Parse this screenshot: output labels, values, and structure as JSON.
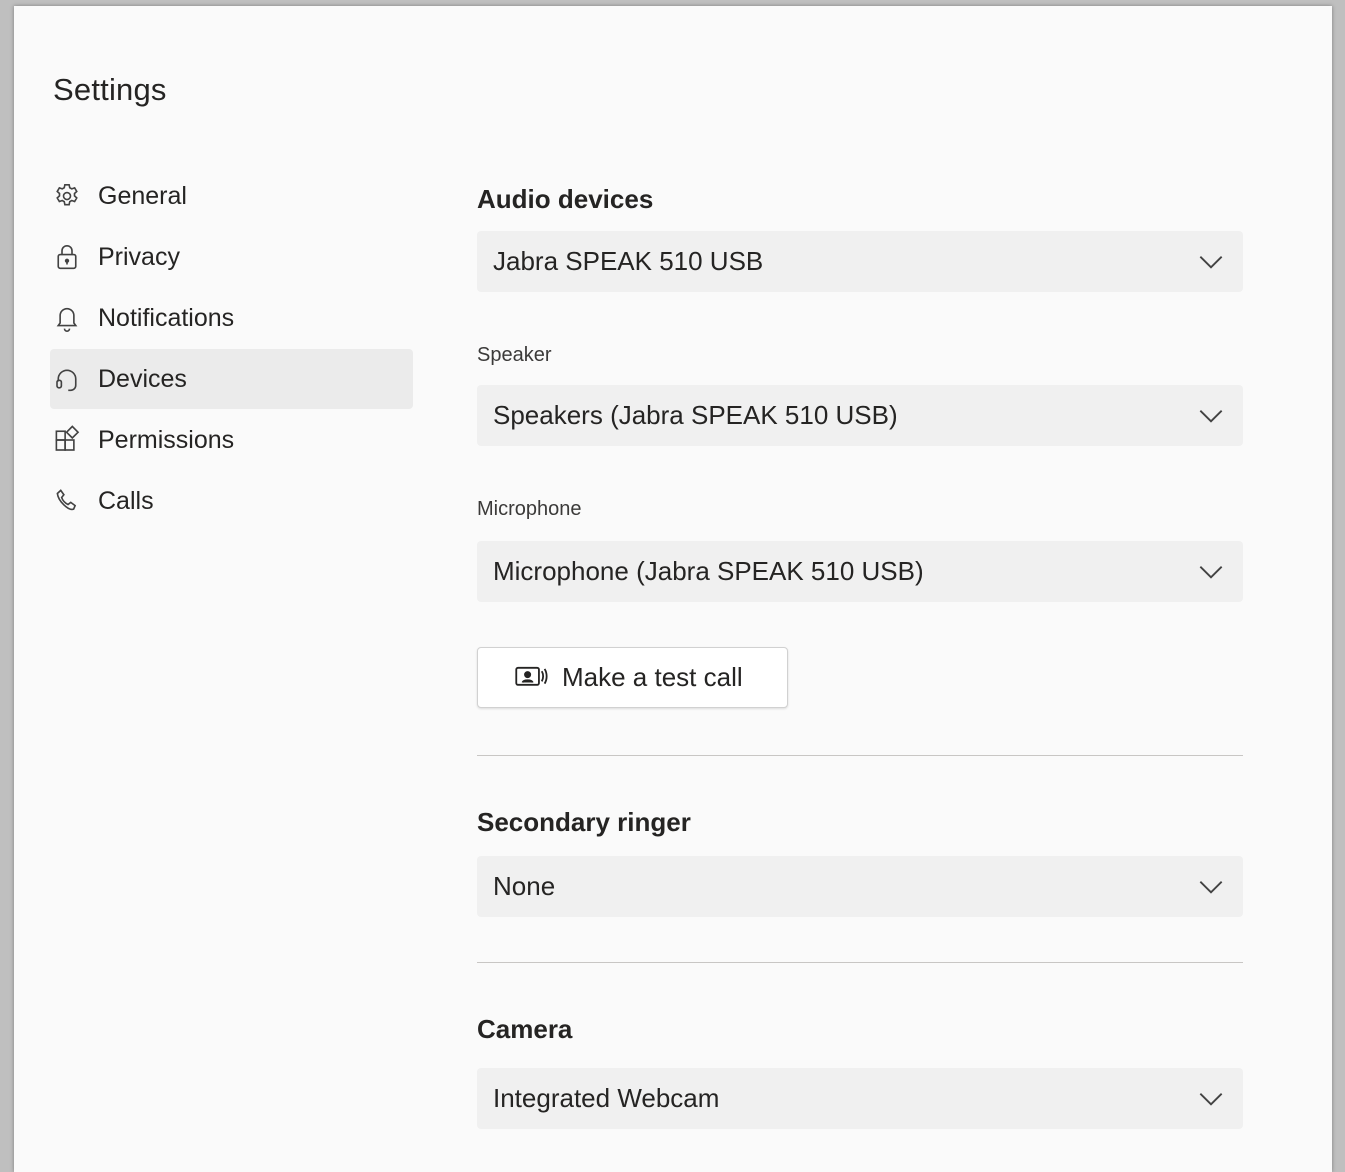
{
  "settings": {
    "title": "Settings"
  },
  "nav": {
    "items": [
      {
        "label": "General",
        "icon": "gear-icon"
      },
      {
        "label": "Privacy",
        "icon": "lock-icon"
      },
      {
        "label": "Notifications",
        "icon": "bell-icon"
      },
      {
        "label": "Devices",
        "icon": "headset-icon",
        "active": true
      },
      {
        "label": "Permissions",
        "icon": "apps-icon"
      },
      {
        "label": "Calls",
        "icon": "phone-icon"
      }
    ]
  },
  "devices": {
    "audio": {
      "heading": "Audio devices",
      "value": "Jabra SPEAK 510 USB"
    },
    "speaker": {
      "label": "Speaker",
      "value": "Speakers (Jabra SPEAK 510 USB)"
    },
    "microphone": {
      "label": "Microphone",
      "value": "Microphone (Jabra SPEAK 510 USB)"
    },
    "test_call": {
      "label": "Make a test call",
      "icon": "test-call-icon"
    },
    "secondary_ringer": {
      "heading": "Secondary ringer",
      "value": "None"
    },
    "camera": {
      "heading": "Camera",
      "value": "Integrated Webcam"
    }
  },
  "colors": {
    "selected_nav_background": "#ebebeb",
    "dropdown_background": "#f0f0f0",
    "divider": "#c8c6c4"
  }
}
